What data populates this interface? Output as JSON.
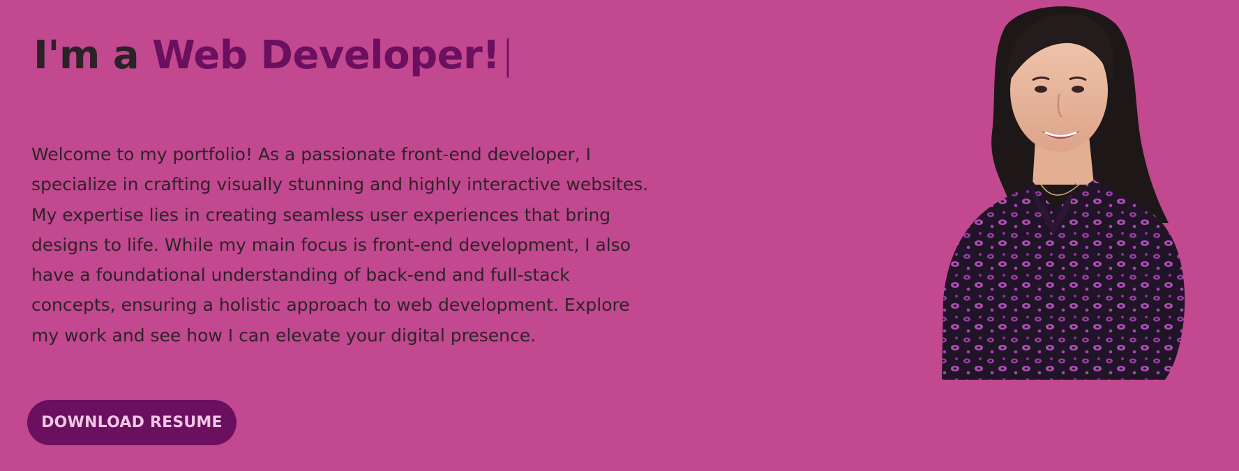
{
  "hero": {
    "headline_prefix": "I'm a",
    "headline_role": "Web Developer!",
    "typing_cursor": "|",
    "intro": "Welcome to my portfolio! As a passionate front-end developer, I specialize in crafting visually stunning and highly interactive websites. My expertise lies in creating seamless user experiences that bring designs to life. While my main focus is front-end development, I also have a foundational understanding of back-end and full-stack concepts, ensuring a holistic approach to web development. Explore my work and see how I can elevate your digital presence.",
    "resume_button_label": "DOWNLOAD RESUME"
  },
  "colors": {
    "background": "#c2488f",
    "accent": "#6b0f5f",
    "button_text": "#f1c6e3",
    "body_text": "#2e2329"
  }
}
